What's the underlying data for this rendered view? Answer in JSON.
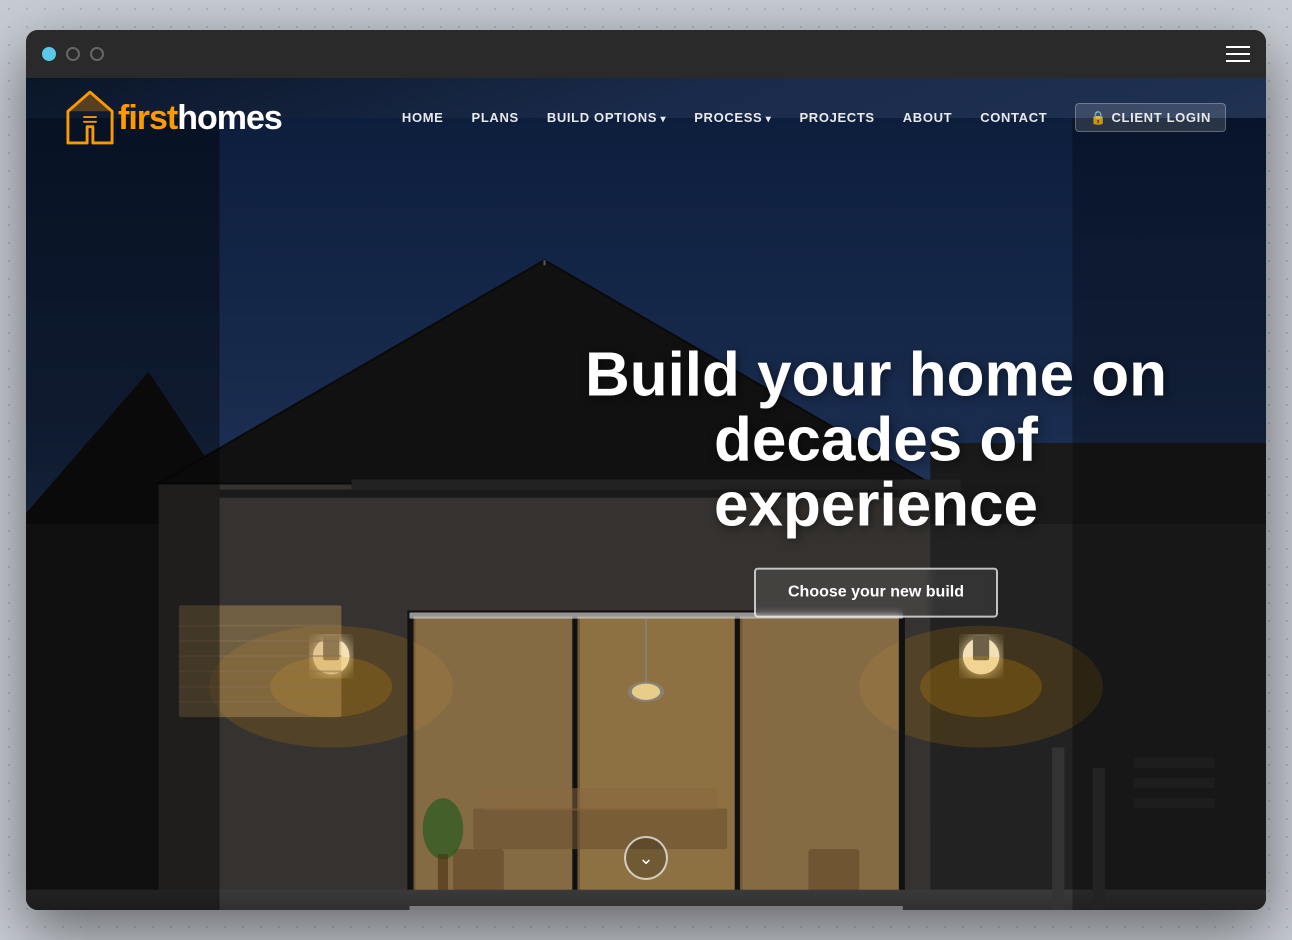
{
  "browser": {
    "dots": [
      "dot1",
      "dot2",
      "dot3"
    ]
  },
  "nav": {
    "logo_first": "first",
    "logo_homes": "homes",
    "links": [
      {
        "label": "HOME",
        "id": "home",
        "dropdown": false
      },
      {
        "label": "PLANS",
        "id": "plans",
        "dropdown": false
      },
      {
        "label": "BUILD OPTIONS",
        "id": "build-options",
        "dropdown": true
      },
      {
        "label": "PROCESS",
        "id": "process",
        "dropdown": true
      },
      {
        "label": "PROJECTS",
        "id": "projects",
        "dropdown": false
      },
      {
        "label": "ABOUT",
        "id": "about",
        "dropdown": false
      },
      {
        "label": "CONTACT",
        "id": "contact",
        "dropdown": false
      }
    ],
    "client_login": "client login"
  },
  "hero": {
    "heading_line1": "Build your home on",
    "heading_line2": "decades of experience",
    "cta_label": "Choose your new build",
    "scroll_icon": "⌄"
  }
}
